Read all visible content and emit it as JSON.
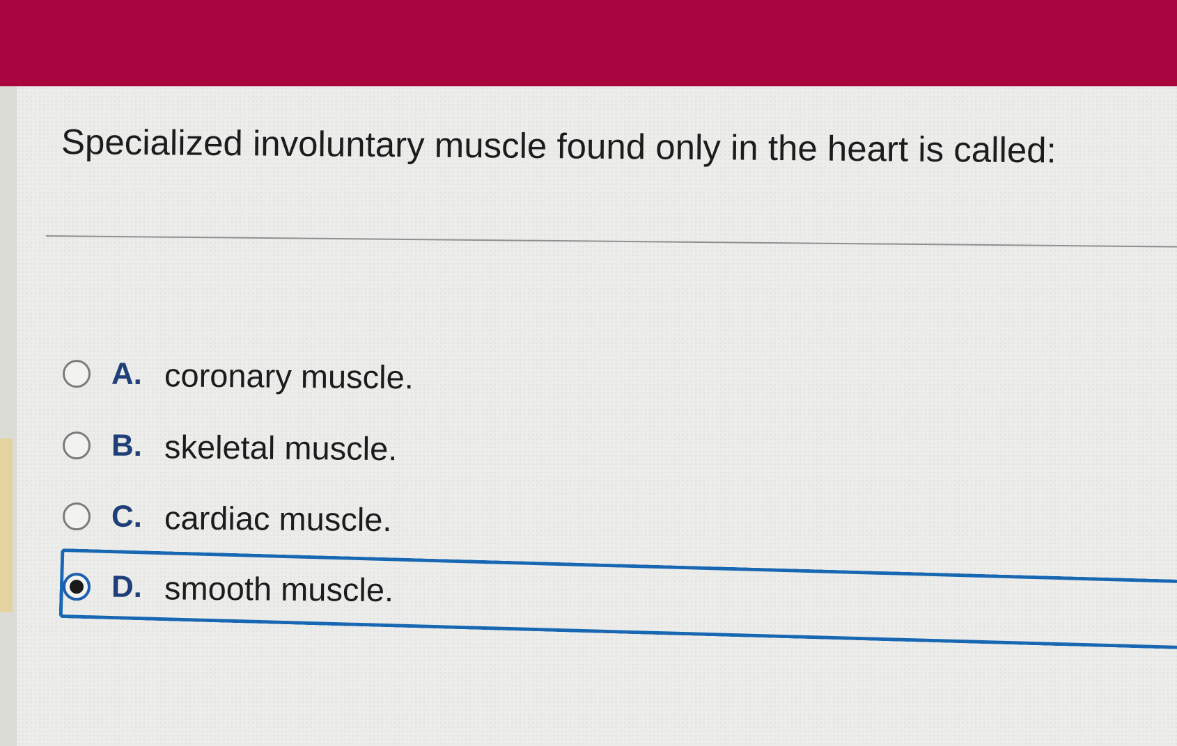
{
  "question": {
    "text": "Specialized involuntary muscle found only in the heart is called:"
  },
  "options": [
    {
      "letter": "A.",
      "text": "coronary muscle.",
      "selected": false
    },
    {
      "letter": "B.",
      "text": "skeletal muscle.",
      "selected": false
    },
    {
      "letter": "C.",
      "text": "cardiac muscle.",
      "selected": false
    },
    {
      "letter": "D.",
      "text": "smooth muscle.",
      "selected": true
    }
  ],
  "colors": {
    "header": "#a8053f",
    "selection_border": "#1767b3",
    "option_letter": "#1f3f78"
  }
}
